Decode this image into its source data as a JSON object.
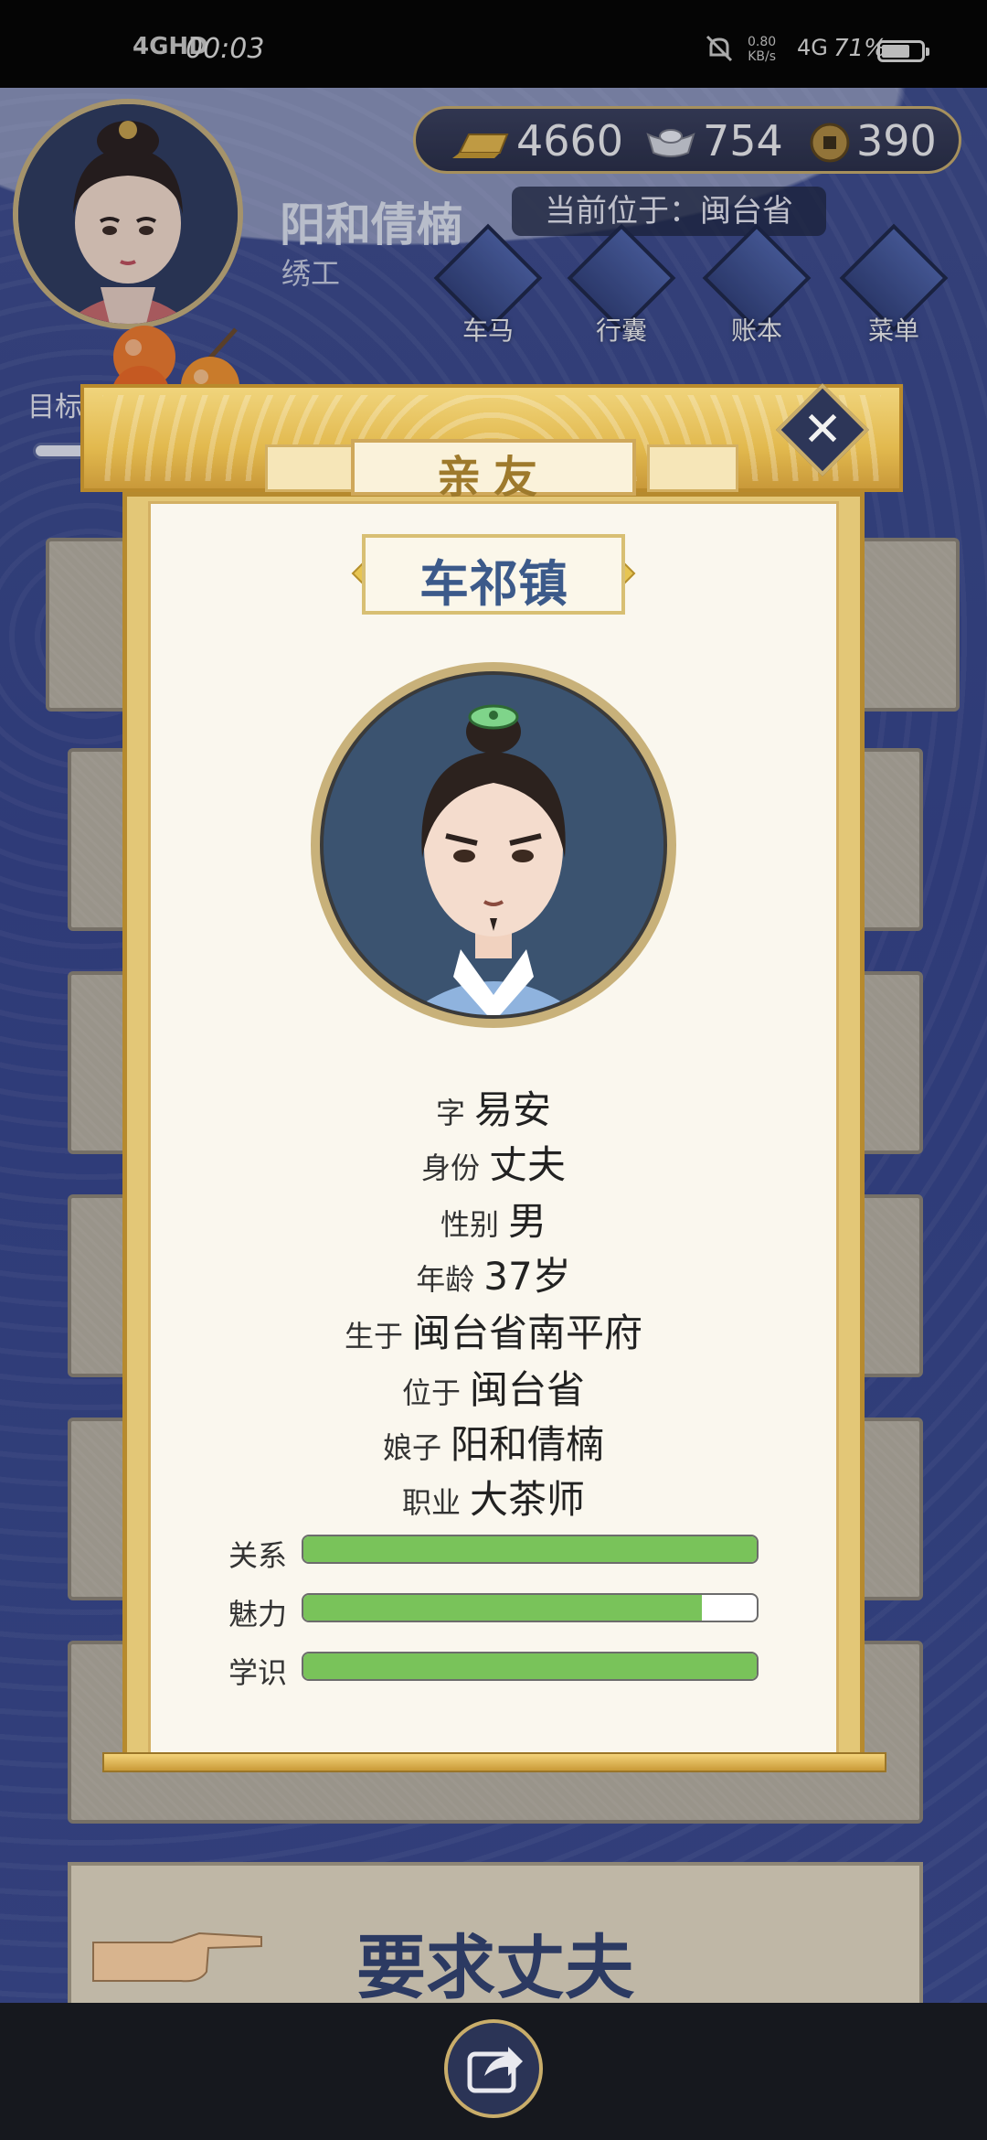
{
  "status_bar": {
    "signal": "4GHD",
    "time": "00:03",
    "speed_value": "0.80",
    "speed_unit": "KB/s",
    "network": "4G",
    "battery": "71%",
    "battery_level": 0.71
  },
  "hud": {
    "currencies": [
      {
        "icon": "gold-bar-icon",
        "value": "4660"
      },
      {
        "icon": "silver-ingot-icon",
        "value": "754"
      },
      {
        "icon": "coin-icon",
        "value": "390"
      }
    ],
    "player_name": "阳和倩楠",
    "player_job": "绣工",
    "location": "当前位于：闽台省",
    "nav": [
      {
        "label": "车马",
        "icon": "carriage-icon"
      },
      {
        "label": "行囊",
        "icon": "bag-icon"
      },
      {
        "label": "账本",
        "icon": "ledger-icon"
      },
      {
        "label": "菜单",
        "icon": "menu-dots-icon"
      }
    ],
    "goal_label": "目标"
  },
  "modal": {
    "title": "亲友",
    "place": "车祁镇",
    "info": [
      {
        "key": "字",
        "value": "易安"
      },
      {
        "key": "身份",
        "value": "丈夫"
      },
      {
        "key": "性别",
        "value": "男"
      },
      {
        "key": "年龄",
        "value": "37岁"
      },
      {
        "key": "生于",
        "value": "闽台省南平府"
      },
      {
        "key": "位于",
        "value": "闽台省"
      },
      {
        "key": "娘子",
        "value": "阳和倩楠"
      },
      {
        "key": "职业",
        "value": "大茶师"
      }
    ],
    "stats": [
      {
        "label": "关系",
        "level": 1.0
      },
      {
        "label": "魅力",
        "level": 0.88
      },
      {
        "label": "学识",
        "level": 1.0
      }
    ]
  },
  "bottom": {
    "action_text": "要求丈夫"
  }
}
